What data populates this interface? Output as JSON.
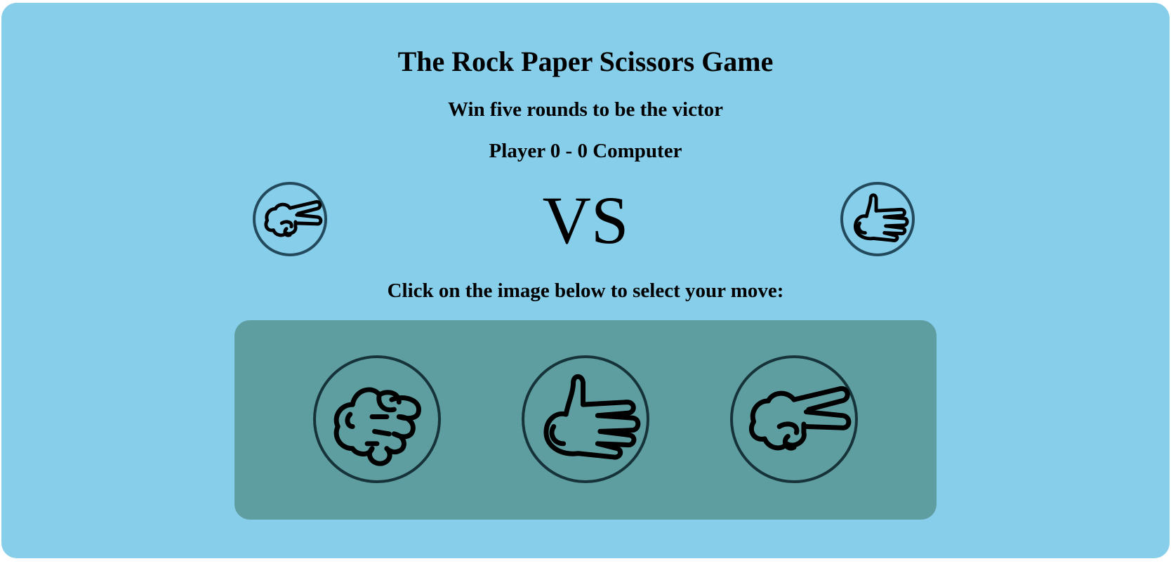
{
  "header": {
    "title": "The Rock Paper Scissors Game",
    "subtitle": "Win five rounds to be the victor"
  },
  "scoreboard": {
    "text": "Player 0 - 0 Computer",
    "player_score": 0,
    "computer_score": 0
  },
  "arena": {
    "vs_label": "VS",
    "player_move_icon": "scissors-hand-icon",
    "computer_move_icon": "paper-hand-icon"
  },
  "instruction": "Click on the image below to select your move:",
  "choices": [
    {
      "move": "rock",
      "icon": "rock-hand-icon"
    },
    {
      "move": "paper",
      "icon": "paper-hand-icon"
    },
    {
      "move": "scissors",
      "icon": "scissors-hand-icon"
    }
  ],
  "colors": {
    "background": "#87ceea",
    "panel": "#5f9ea0",
    "ring": "#16333a"
  }
}
